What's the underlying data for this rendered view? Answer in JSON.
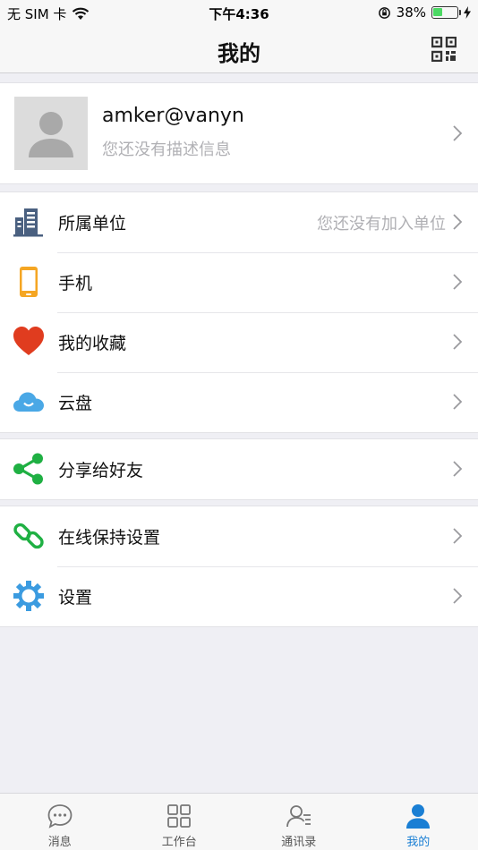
{
  "status_bar": {
    "carrier": "无 SIM 卡",
    "time": "下午4:36",
    "battery": "38%",
    "battery_level": 0.38
  },
  "nav": {
    "title": "我的",
    "action_icon": "qr-code-icon"
  },
  "profile": {
    "name": "amker@vanyn",
    "description": "您还没有描述信息"
  },
  "groups": [
    {
      "rows": [
        {
          "label": "所属单位",
          "value": "您还没有加入单位",
          "icon": "building-icon",
          "color": "#4a6080"
        },
        {
          "label": "手机",
          "icon": "phone-icon",
          "color": "#f5a623"
        },
        {
          "label": "我的收藏",
          "icon": "heart-icon",
          "color": "#e03c1f"
        },
        {
          "label": "云盘",
          "icon": "cloud-icon",
          "color": "#4aa8e6"
        }
      ]
    },
    {
      "rows": [
        {
          "label": "分享给好友",
          "icon": "share-icon",
          "color": "#1fb043"
        }
      ]
    },
    {
      "rows": [
        {
          "label": "在线保持设置",
          "icon": "link-icon",
          "color": "#1fb043"
        },
        {
          "label": "设置",
          "icon": "gear-icon",
          "color": "#3b9be0"
        }
      ]
    }
  ],
  "tab_bar": {
    "tabs": [
      {
        "label": "消息",
        "icon": "message-icon"
      },
      {
        "label": "工作台",
        "icon": "grid-icon"
      },
      {
        "label": "通讯录",
        "icon": "contacts-icon"
      },
      {
        "label": "我的",
        "icon": "person-icon",
        "active": true
      }
    ],
    "active_color": "#1a7fd4"
  }
}
